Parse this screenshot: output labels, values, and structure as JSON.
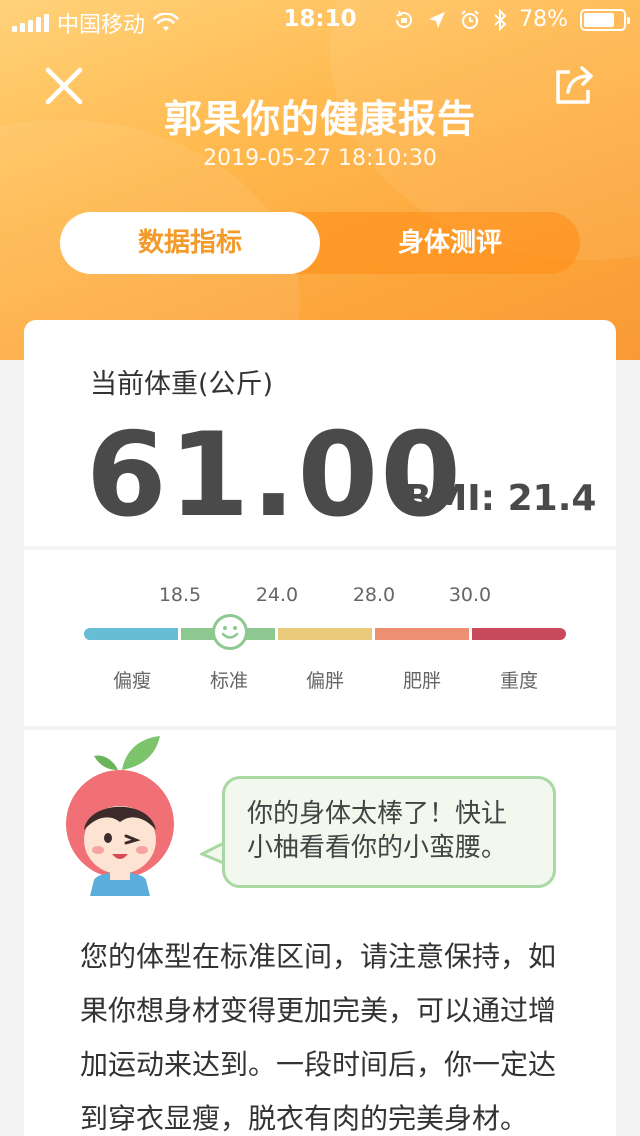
{
  "status_bar": {
    "carrier": "中国移动",
    "time": "18:10",
    "battery": "78%",
    "battery_level": 0.78
  },
  "header": {
    "title": "郭果你的健康报告",
    "datetime": "2019-05-27 18:10:30"
  },
  "tabs": [
    {
      "label": "数据指标",
      "active": true
    },
    {
      "label": "身体测评",
      "active": false
    }
  ],
  "weight": {
    "label": "当前体重(公斤)",
    "value": "61.00",
    "bmi_label": "BMI:",
    "bmi_value": "21.4"
  },
  "bmi_scale": {
    "ticks": [
      "18.5",
      "24.0",
      "28.0",
      "30.0"
    ],
    "categories": [
      "偏瘦",
      "标准",
      "偏胖",
      "肥胖",
      "重度"
    ],
    "colors": [
      "#67bcd6",
      "#8ec891",
      "#e8ca7a",
      "#ec8f72",
      "#c94a5a"
    ],
    "current_category": "标准",
    "indicator_icon": "smiley-face-icon"
  },
  "advice": {
    "bubble_text": "你的身体太棒了！快让小柚看看你的小蛮腰。",
    "body_text": "您的体型在标准区间，请注意保持，如果你想身材变得更加完美，可以通过增加运动来达到。一段时间后，你一定达到穿衣显瘦，脱衣有肉的完美身材。"
  },
  "icons": {
    "close": "close-icon",
    "share": "share-icon",
    "mascot": "grapefruit-mascot-icon"
  }
}
